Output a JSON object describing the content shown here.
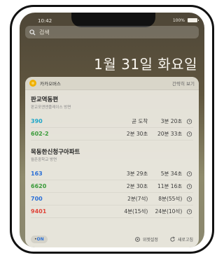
{
  "status": {
    "time": "10:42",
    "battery": "100%"
  },
  "search": {
    "placeholder": "검색"
  },
  "date": "1월 31일 화요일",
  "widget": {
    "app_name": "카카오버스",
    "collapse_label": "간략히 보기",
    "stops": [
      {
        "name": "판교역동편",
        "direction": "판교포앤앤플레이스 방면",
        "routes": [
          {
            "number": "390",
            "color": "#1ea6c9",
            "first": "곧 도착",
            "second": "3분 20초"
          },
          {
            "number": "602-2",
            "color": "#3a9b3a",
            "first": "2분 30초",
            "second": "20분 33초"
          }
        ]
      },
      {
        "name": "목동한신청구아파트",
        "direction": "월촌중학교 방면",
        "routes": [
          {
            "number": "163",
            "color": "#2a6fd6",
            "first": "3분 29초",
            "second": "5분 34초"
          },
          {
            "number": "6620",
            "color": "#3a9b3a",
            "first": "2분 30초",
            "second": "11분 16초"
          },
          {
            "number": "700",
            "color": "#2a6fd6",
            "first": "2분(7석)",
            "second": "8분(55석)"
          },
          {
            "number": "9401",
            "color": "#e0453a",
            "first": "4분(15석)",
            "second": "24분(10석)"
          }
        ]
      }
    ],
    "footer": {
      "toggle": "ON",
      "settings": "위젯설정",
      "refresh": "새로고침"
    }
  }
}
